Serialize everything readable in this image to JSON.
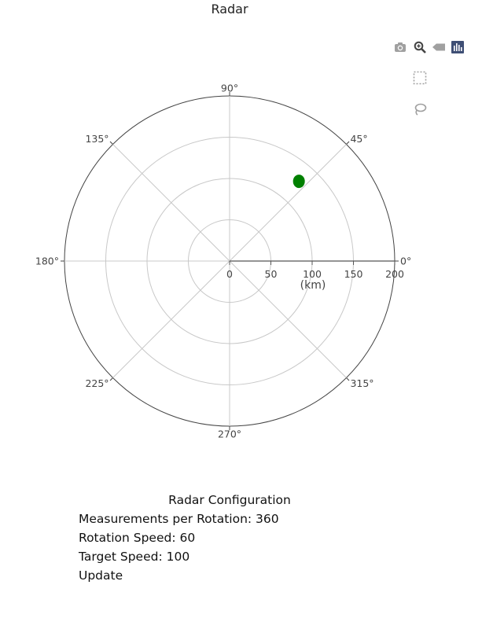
{
  "page": {
    "title": "Radar"
  },
  "modebar": {
    "buttons": [
      {
        "name": "camera-icon",
        "tooltip": "Download plot as a png"
      },
      {
        "name": "zoom-icon",
        "tooltip": "Zoom"
      },
      {
        "name": "pan-icon",
        "tooltip": "Pan"
      },
      {
        "name": "plotly-logo-icon",
        "tooltip": "Produced with Plotly"
      },
      {
        "name": "box-select-icon",
        "tooltip": "Box Select"
      },
      {
        "name": "lasso-select-icon",
        "tooltip": "Lasso Select"
      }
    ]
  },
  "chart_data": {
    "type": "scatter",
    "projection": "polar",
    "title": "Radar",
    "radial_axis": {
      "range": [
        0,
        200
      ],
      "tick_values": [
        0,
        50,
        100,
        150,
        200
      ],
      "tick_labels": [
        "0",
        "50",
        "100",
        "150",
        "200"
      ],
      "title": "(km)",
      "angle_deg": 0
    },
    "angular_axis": {
      "tick_values_deg": [
        0,
        45,
        90,
        135,
        180,
        225,
        270,
        315
      ],
      "tick_labels": [
        "0°",
        "45°",
        "90°",
        "135°",
        "180°",
        "225°",
        "270°",
        "315°"
      ],
      "direction": "counterclockwise",
      "rotation_deg": 0
    },
    "grid": true,
    "series": [
      {
        "points": [
          {
            "r": 128,
            "theta_deg": 49
          }
        ],
        "marker_color": "#008000"
      }
    ]
  },
  "config": {
    "title": "Radar Configuration",
    "measurements_label": "Measurements per Rotation: 360",
    "rotation_label": "Rotation Speed: 60",
    "target_label": "Target Speed: 100",
    "update_label": "Update"
  },
  "colors": {
    "grid": "#c8c8c8",
    "outer_ring": "#444444",
    "marker": "#008000",
    "modebar_icon": "#a0a0a0",
    "plotly_logo_bg": "#3f4f75"
  }
}
